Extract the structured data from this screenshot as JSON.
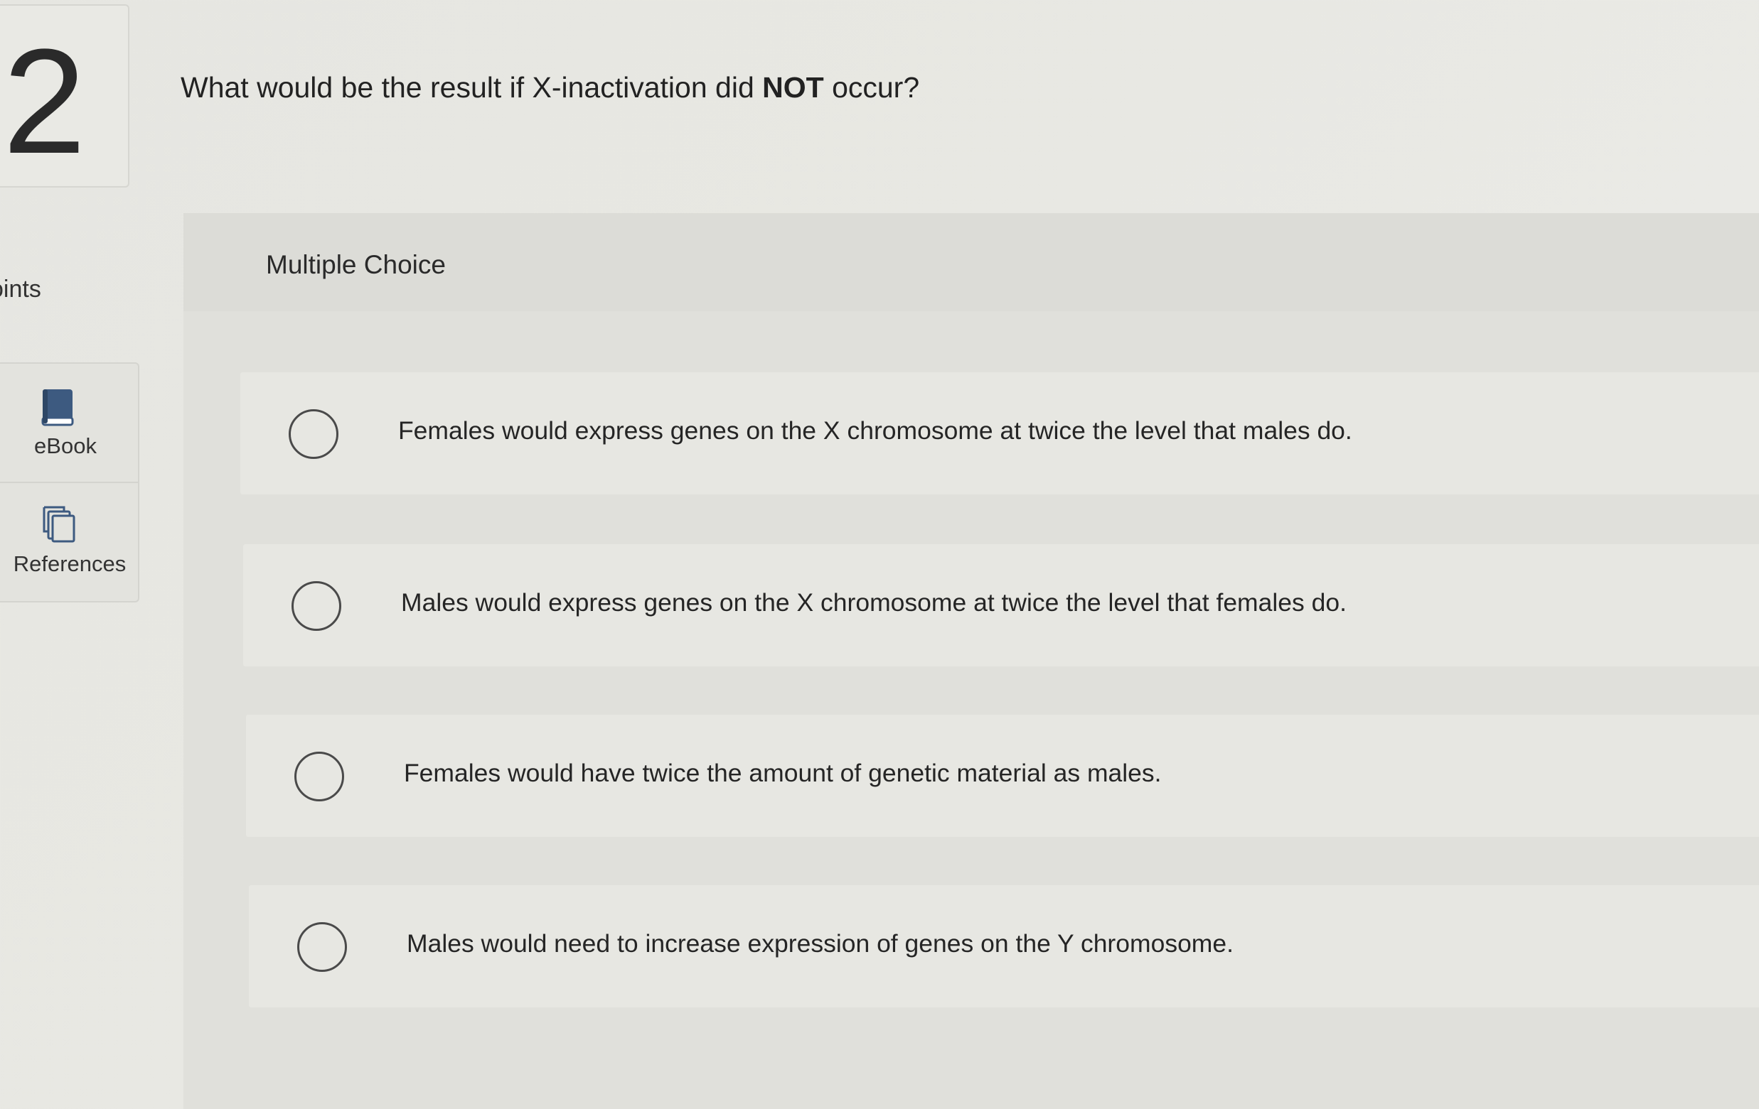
{
  "question": {
    "number": "2",
    "prefix": "What would be the result if X-inactivation did ",
    "emphasis": "NOT",
    "suffix": " occur?"
  },
  "sidebar": {
    "points_label": "oints",
    "tools": [
      {
        "label": "eBook",
        "icon": "book-icon"
      },
      {
        "label": "References",
        "icon": "copy-pages-icon"
      }
    ]
  },
  "panel": {
    "type_label": "Multiple Choice",
    "options": [
      {
        "text": "Females would express genes on the X chromosome at twice the level that males do.",
        "selected": false
      },
      {
        "text": "Males would express genes on the X chromosome at twice the level that females do.",
        "selected": false
      },
      {
        "text": "Females would have twice the amount of genetic material as males.",
        "selected": false
      },
      {
        "text": "Males would need to increase expression of genes on the Y chromosome.",
        "selected": false
      }
    ]
  },
  "colors": {
    "background": "#e8e8e3",
    "panel": "#e0e0db",
    "option": "#e7e7e2",
    "ebook_icon": "#3d5a80",
    "text": "#232323"
  }
}
